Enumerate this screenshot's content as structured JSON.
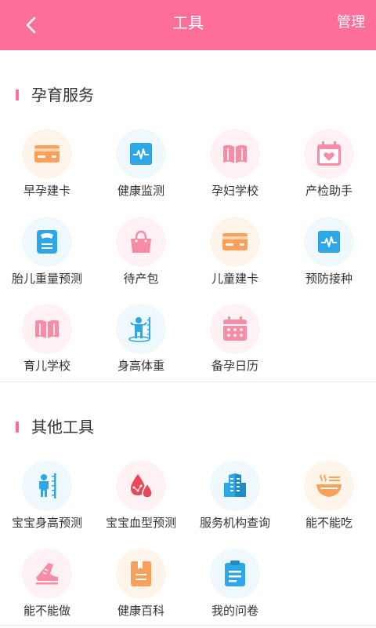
{
  "header": {
    "title": "工具",
    "manage_label": "管理"
  },
  "sections": [
    {
      "title": "孕育服务",
      "items": [
        {
          "label": "早孕建卡",
          "icon": "card-icon",
          "color": "#f9a05a"
        },
        {
          "label": "健康监测",
          "icon": "heartbeat-monitor-icon",
          "color": "#2ea7e6"
        },
        {
          "label": "孕妇学校",
          "icon": "open-book-icon",
          "color": "#f78ca7"
        },
        {
          "label": "产检助手",
          "icon": "calendar-heart-icon",
          "color": "#f78ca7"
        },
        {
          "label": "胎儿重量预测",
          "icon": "scale-icon",
          "color": "#2ea7e6"
        },
        {
          "label": "待产包",
          "icon": "handbag-icon",
          "color": "#f78ca7"
        },
        {
          "label": "儿童建卡",
          "icon": "card-icon",
          "color": "#f9a05a"
        },
        {
          "label": "预防接种",
          "icon": "heartbeat-monitor-icon",
          "color": "#2ea7e6"
        },
        {
          "label": "育儿学校",
          "icon": "open-book-icon",
          "color": "#f78ca7"
        },
        {
          "label": "身高体重",
          "icon": "child-height-icon",
          "color": "#2ea7e6"
        },
        {
          "label": "备孕日历",
          "icon": "calendar-icon",
          "color": "#f78ca7"
        }
      ]
    },
    {
      "title": "其他工具",
      "items": [
        {
          "label": "宝宝身高预测",
          "icon": "height-ruler-icon",
          "color": "#2ea7e6"
        },
        {
          "label": "宝宝血型预测",
          "icon": "blood-drop-icon",
          "color": "#e9485b"
        },
        {
          "label": "服务机构查询",
          "icon": "building-icon",
          "color": "#2ea7e6"
        },
        {
          "label": "能不能吃",
          "icon": "noodle-bowl-icon",
          "color": "#f9a05a"
        },
        {
          "label": "能不能做",
          "icon": "shoe-icon",
          "color": "#f78ca7"
        },
        {
          "label": "健康百科",
          "icon": "document-icon",
          "color": "#f9a05a"
        },
        {
          "label": "我的问卷",
          "icon": "clipboard-icon",
          "color": "#2ea7e6"
        }
      ]
    }
  ]
}
